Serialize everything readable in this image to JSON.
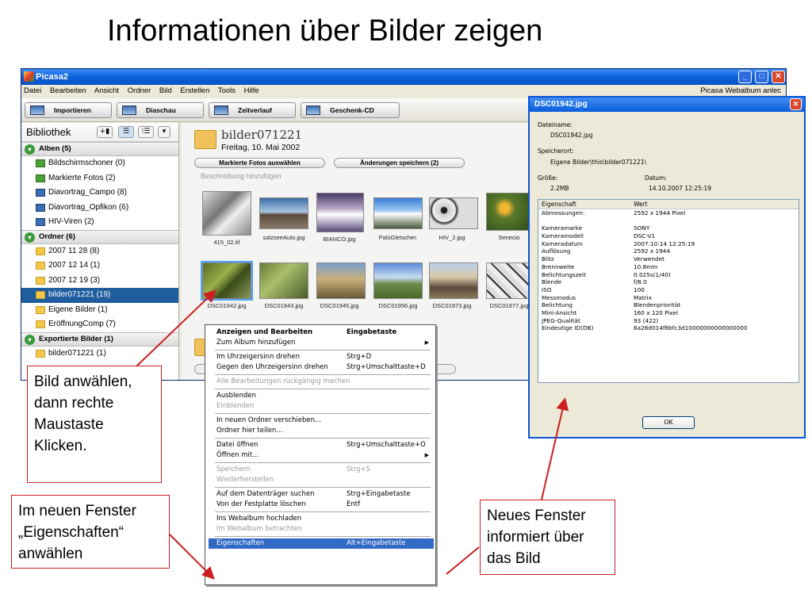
{
  "slide": {
    "title": "Informationen über Bilder zeigen"
  },
  "picasa": {
    "title": "Picasa2",
    "menu": [
      "Datei",
      "Bearbeiten",
      "Ansicht",
      "Ordner",
      "Bild",
      "Erstellen",
      "Tools",
      "Hilfe"
    ],
    "menu_right": "Picasa Webalbum anlec",
    "toolbar": [
      "Importieren",
      "Diaschau",
      "Zeitverlauf",
      "Geschenk-CD"
    ],
    "library": {
      "title": "Bibliothek",
      "groups": [
        {
          "label": "Alben (5)",
          "items": [
            "Bildschirmschoner (0)",
            "Markierte Fotos (2)",
            "Diavortrag_Campo (8)",
            "Diavortrag_Opfikon (6)",
            "HIV-Viren (2)"
          ]
        },
        {
          "label": "Ordner (6)",
          "items": [
            "2007 11 28 (8)",
            "2007 12 14 (1)",
            "2007 12 19 (3)",
            "bilder071221 (19)",
            "Eigene Bilder (1)",
            "EröffnungComp (7)"
          ]
        },
        {
          "label": "Exportierte Bilder (1)",
          "items": [
            "bilder071221 (1)"
          ]
        }
      ],
      "selected_item": "bilder071221 (19)"
    },
    "album": {
      "name": "bilder071221",
      "date": "Freitag, 10. Mai 2002",
      "btn_mark": "Markierte Fotos auswählen",
      "btn_save": "Änderungen speichern (2)",
      "description_placeholder": "Beschreibung hinzufügen",
      "row1": [
        "415_02.tif",
        "salzseeAuto.jpg",
        "BIANCO.jpg",
        "PalüGletscher.",
        "HIV_2.jpg",
        "Senecio"
      ],
      "row2": [
        "DSC01942.jpg",
        "DSC01943.jpg",
        "DSC01945.jpg",
        "DSC01956.jpg",
        "DSC01973.jpg",
        "DSC01977.jpg"
      ]
    }
  },
  "dialog": {
    "title": "DSC01942.jpg",
    "filename_label": "Dateiname:",
    "filename": "DSC01942.jpg",
    "location_label": "Speicherort:",
    "location": "Eigene Bilder\\this\\bilder071221\\",
    "size_label": "Größe:",
    "size": "2.2MB",
    "date_label": "Datum:",
    "date": "14.10.2007 12:25:19",
    "col_property": "Eigenschaft",
    "col_value": "Wert",
    "rows": [
      [
        "Abmessungen:",
        "2592 x 1944 Pixel"
      ],
      [
        "",
        ""
      ],
      [
        "Kameramarke",
        "SONY"
      ],
      [
        "Kameramodell",
        "DSC-V1"
      ],
      [
        "Kameradatum",
        "2007:10:14 12:25:19"
      ],
      [
        "Auflösung",
        "2592 x 1944"
      ],
      [
        "Blitz",
        "Verwendet"
      ],
      [
        "Brennweite",
        "10.8mm"
      ],
      [
        "Belichtungszeit",
        " 0.025s(1/40)"
      ],
      [
        "Blende",
        "f/8.0"
      ],
      [
        "ISO",
        "100"
      ],
      [
        "Messmodus",
        "Matrix"
      ],
      [
        "Belichtung",
        "Blendenpriorität"
      ],
      [
        "Mini-Ansicht",
        "160 x 120 Pixel"
      ],
      [
        "JPEG-Qualität",
        "93 (422)"
      ],
      [
        "Eindeutige ID(DB)",
        "6a26d014f8bfc3d10000000000000000"
      ]
    ],
    "ok": "OK"
  },
  "context_menu": {
    "items": [
      {
        "label": "Anzeigen und Bearbeiten",
        "shortcut": "Eingabetaste",
        "bold": true
      },
      {
        "label": "Zum Album hinzufügen",
        "submenu": true
      },
      {
        "sep": true
      },
      {
        "label": "Im Uhrzeigersinn drehen",
        "shortcut": "Strg+D"
      },
      {
        "label": "Gegen den Uhrzeigersinn drehen",
        "shortcut": "Strg+Umschalttaste+D"
      },
      {
        "sep": true
      },
      {
        "label": "Alle Bearbeitungen rückgängig machen",
        "disabled": true
      },
      {
        "sep": true
      },
      {
        "label": "Ausblenden"
      },
      {
        "label": "Einblenden",
        "disabled": true
      },
      {
        "sep": true
      },
      {
        "label": "In neuen Ordner verschieben..."
      },
      {
        "label": "Ordner hier teilen..."
      },
      {
        "sep": true
      },
      {
        "label": "Datei öffnen",
        "shortcut": "Strg+Umschalttaste+O"
      },
      {
        "label": "Öffnen mit...",
        "submenu": true
      },
      {
        "sep": true
      },
      {
        "label": "Speichern",
        "shortcut": "Strg+S",
        "disabled": true
      },
      {
        "label": "Wiederherstellen",
        "disabled": true
      },
      {
        "sep": true
      },
      {
        "label": "Auf dem Datenträger suchen",
        "shortcut": "Strg+Eingabetaste"
      },
      {
        "label": "Von der Festplatte löschen",
        "shortcut": "Entf"
      },
      {
        "sep": true
      },
      {
        "label": "Ins Webalbum hochladen"
      },
      {
        "label": "Im Webalbum betrachten",
        "disabled": true
      },
      {
        "sep": true
      },
      {
        "label": "Eigenschaften",
        "shortcut": "Alt+Eingabetaste",
        "highlight": true
      }
    ]
  },
  "callouts": {
    "select": [
      "Bild anwählen,",
      "dann rechte",
      "Maustaste",
      "Klicken."
    ],
    "properties": [
      "Im neuen Fenster",
      "„Eigenschaften“",
      "anwählen"
    ],
    "info": [
      "Neues Fenster",
      "informiert über",
      "das Bild"
    ]
  },
  "colors": {
    "accent": "#CC1F1F",
    "selection": "#316AC5",
    "title_bar": "#0A5FD8"
  }
}
